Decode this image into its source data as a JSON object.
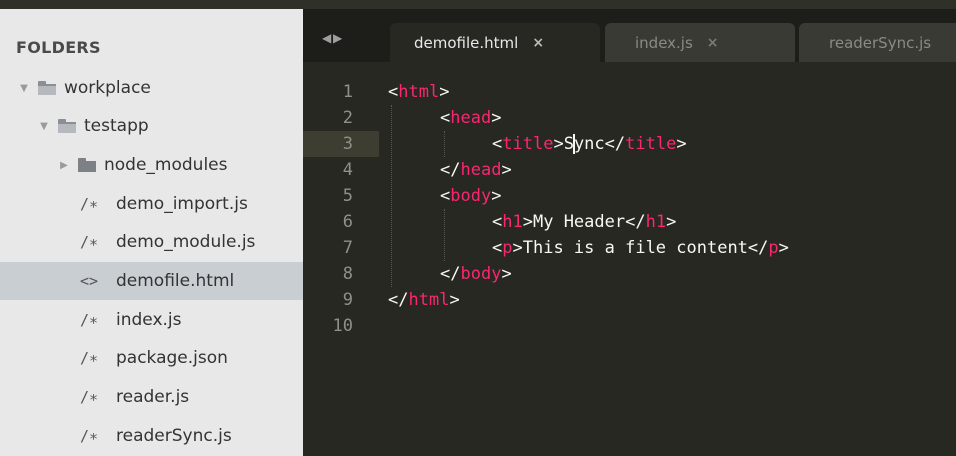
{
  "sidebar": {
    "title": "FOLDERS",
    "items": [
      {
        "label": "workplace",
        "kind": "folder-open",
        "indent": 0,
        "selected": false
      },
      {
        "label": "testapp",
        "kind": "folder-open",
        "indent": 1,
        "selected": false
      },
      {
        "label": "node_modules",
        "kind": "folder-closed",
        "indent": 2,
        "selected": false
      },
      {
        "label": "demo_import.js",
        "kind": "file",
        "icon": "/∗",
        "indent": 2,
        "selected": false
      },
      {
        "label": "demo_module.js",
        "kind": "file",
        "icon": "/∗",
        "indent": 2,
        "selected": false
      },
      {
        "label": "demofile.html",
        "kind": "file",
        "icon": "<>",
        "indent": 2,
        "selected": true
      },
      {
        "label": "index.js",
        "kind": "file",
        "icon": "/∗",
        "indent": 2,
        "selected": false
      },
      {
        "label": "package.json",
        "kind": "file",
        "icon": "/∗",
        "indent": 2,
        "selected": false
      },
      {
        "label": "reader.js",
        "kind": "file",
        "icon": "/∗",
        "indent": 2,
        "selected": false
      },
      {
        "label": "readerSync.js",
        "kind": "file",
        "icon": "/∗",
        "indent": 2,
        "selected": false
      }
    ]
  },
  "tabbar": {
    "nav_arrows": "◀ ▶",
    "tabs": [
      {
        "label": "demofile.html",
        "close": "×",
        "active": true
      },
      {
        "label": "index.js",
        "close": "×",
        "active": false
      },
      {
        "label": "readerSync.js",
        "close": "",
        "active": false
      }
    ]
  },
  "editor": {
    "line_numbers": [
      "1",
      "2",
      "3",
      "4",
      "5",
      "6",
      "7",
      "8",
      "9",
      "10"
    ],
    "active_line": 3,
    "lines": {
      "l1": {
        "lt": "<",
        "tag": "html",
        "gt": ">"
      },
      "l2": {
        "lt": "<",
        "tag": "head",
        "gt": ">"
      },
      "l3": {
        "lt": "<",
        "tag": "title",
        "gt": ">",
        "text_a": "S",
        "text_b": "ync",
        "lt2": "</",
        "tag2": "title",
        "gt2": ">"
      },
      "l4": {
        "lt": "</",
        "tag": "head",
        "gt": ">"
      },
      "l5": {
        "lt": "<",
        "tag": "body",
        "gt": ">"
      },
      "l6": {
        "lt": "<",
        "tag": "h1",
        "gt": ">",
        "text": "My Header",
        "lt2": "</",
        "tag2": "h1",
        "gt2": ">"
      },
      "l7": {
        "lt": "<",
        "tag": "p",
        "gt": ">",
        "text": "This is a file content",
        "lt2": "</",
        "tag2": "p",
        "gt2": ">"
      },
      "l8": {
        "lt": "</",
        "tag": "body",
        "gt": ">"
      },
      "l9": {
        "lt": "</",
        "tag": "html",
        "gt": ">"
      }
    }
  },
  "colors": {
    "editor_bg": "#272822",
    "tag": "#f92672",
    "text": "#f8f8f2",
    "sidebar_bg": "#e8e8e8",
    "selected_row": "#c9ced3"
  }
}
